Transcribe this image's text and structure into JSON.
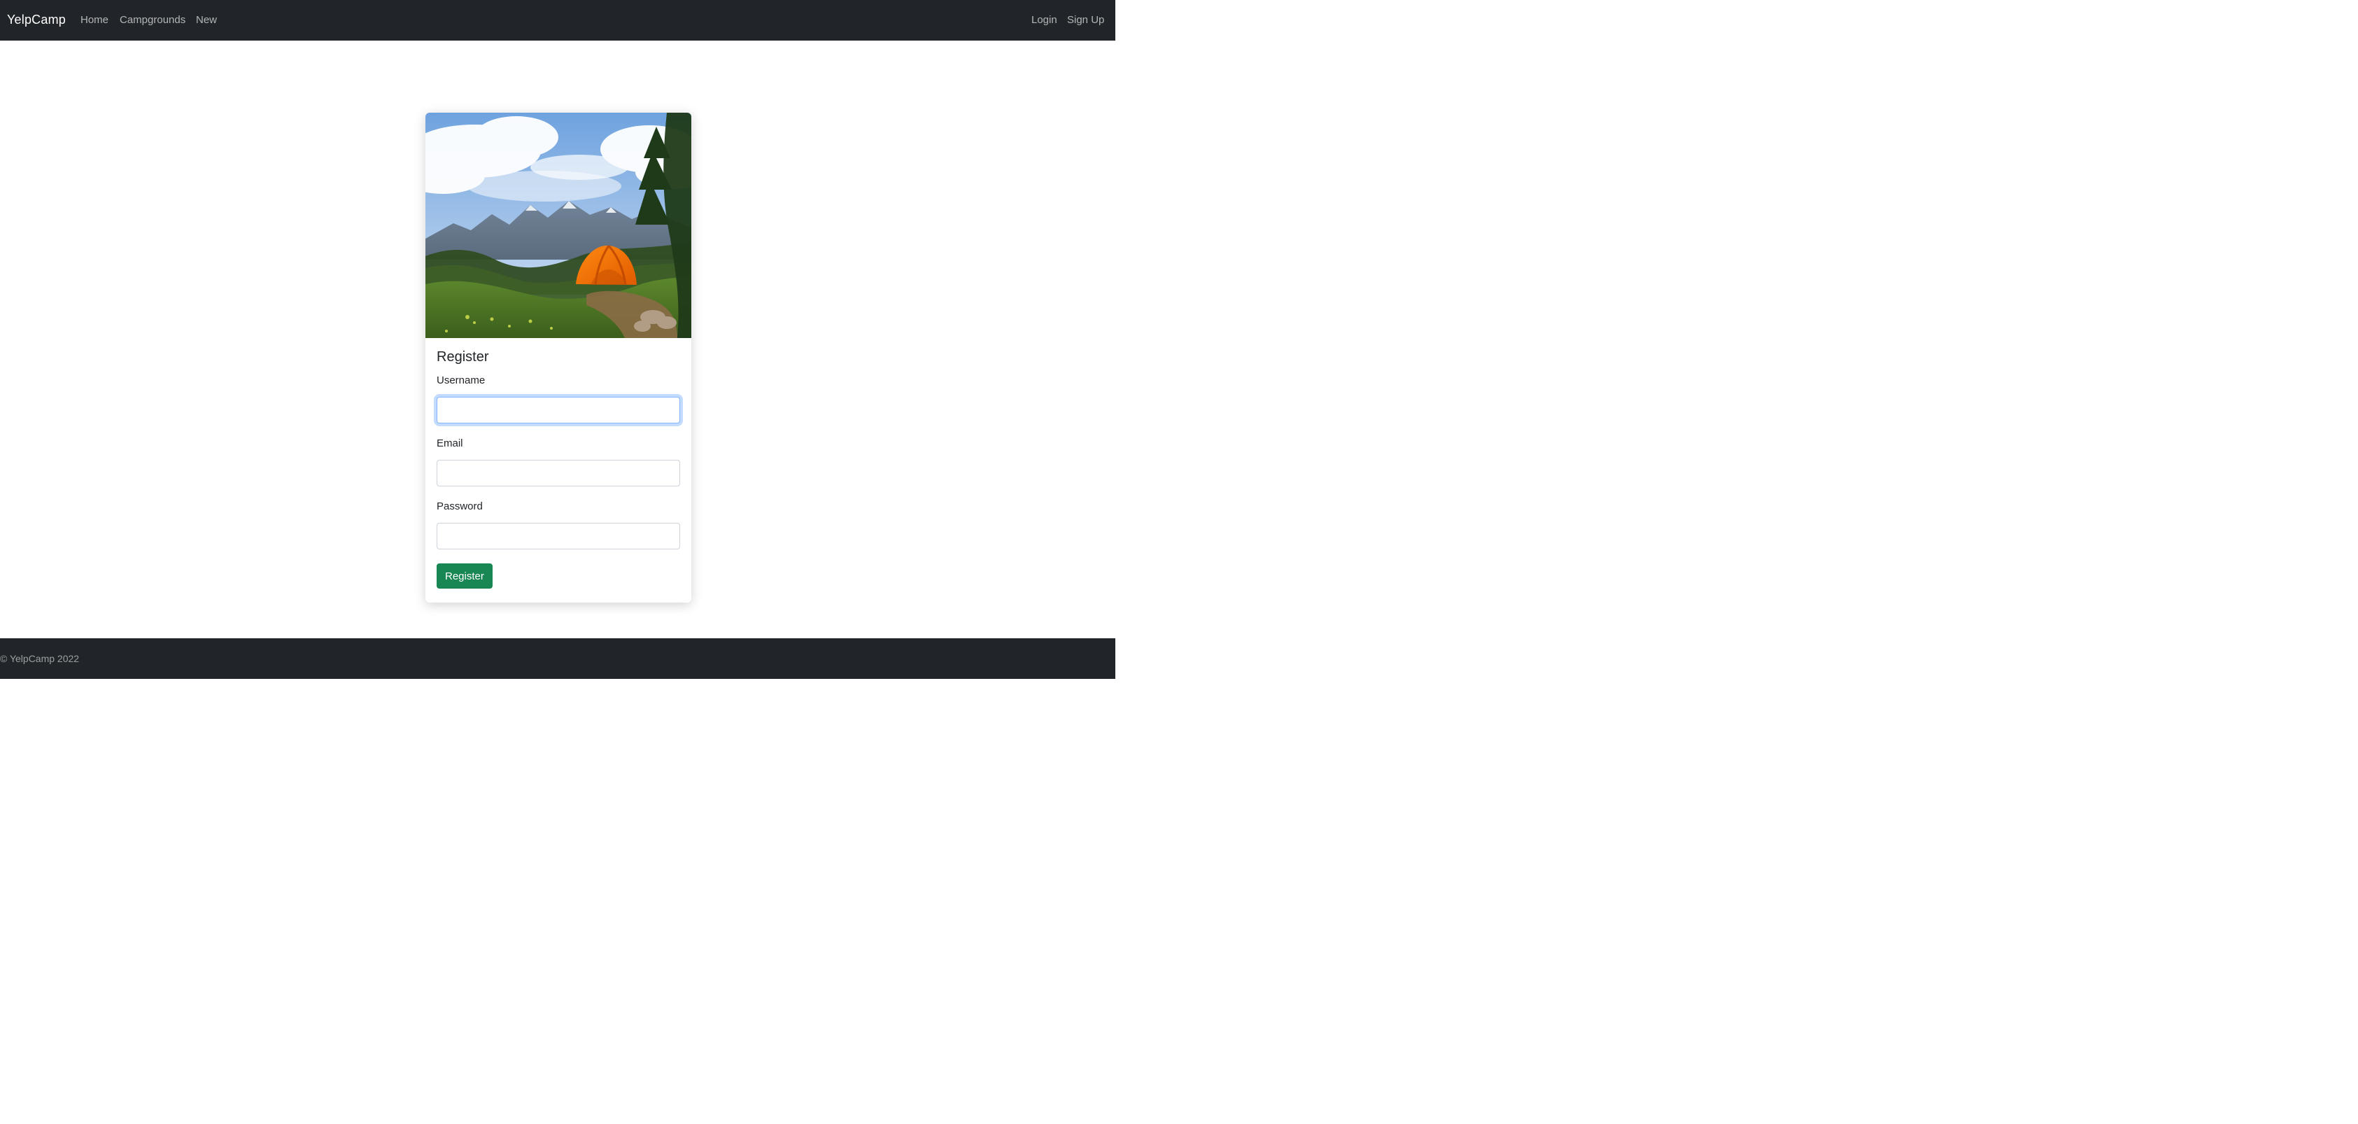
{
  "navbar": {
    "brand": "YelpCamp",
    "links": [
      {
        "label": "Home"
      },
      {
        "label": "Campgrounds"
      },
      {
        "label": "New"
      }
    ],
    "auth_links": [
      {
        "label": "Login"
      },
      {
        "label": "Sign Up"
      }
    ],
    "background_color": "#212529"
  },
  "card": {
    "image_alt": "Orange tent in a mountain meadow",
    "title": "Register",
    "form": {
      "username": {
        "label": "Username",
        "value": "",
        "placeholder": ""
      },
      "email": {
        "label": "Email",
        "value": "",
        "placeholder": ""
      },
      "password": {
        "label": "Password",
        "value": "",
        "placeholder": ""
      },
      "submit_label": "Register",
      "submit_color": "#198754"
    }
  },
  "footer": {
    "text": "© YelpCamp 2022",
    "background_color": "#212529"
  }
}
